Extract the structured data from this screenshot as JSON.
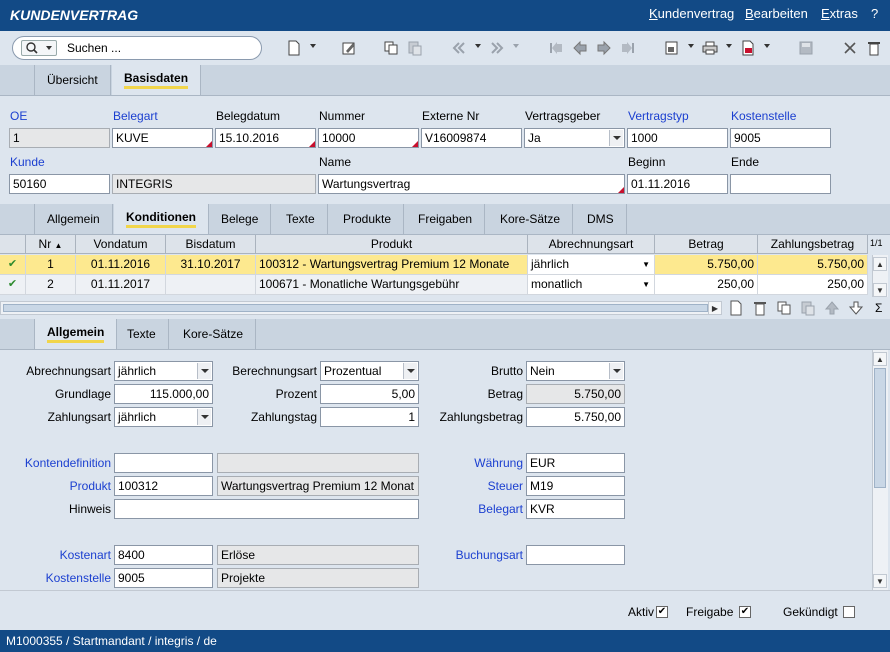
{
  "app": {
    "title": "KUNDENVERTRAG",
    "menu": [
      {
        "label": "Kundenvertrag",
        "key": "K",
        "rest": "undenvertrag"
      },
      {
        "label": "Bearbeiten",
        "key": "B",
        "rest": "earbeiten"
      },
      {
        "label": "Extras",
        "key": "E",
        "rest": "xtras"
      },
      {
        "label": "?",
        "key": "",
        "rest": "?"
      }
    ]
  },
  "toolbar": {
    "search_label": "Suchen ...",
    "icons": [
      "new-document-icon",
      "edit-icon",
      "copy-icon",
      "paste-icon",
      "fast-back-icon",
      "fast-forward-icon",
      "first-record-icon",
      "previous-record-icon",
      "next-record-icon",
      "last-record-icon",
      "export-icon",
      "print-icon",
      "pdf-icon",
      "save-icon",
      "close-icon",
      "delete-icon"
    ]
  },
  "main_tabs": [
    {
      "label": "Übersicht",
      "active": false
    },
    {
      "label": "Basisdaten",
      "active": true
    }
  ],
  "header": {
    "oe": {
      "label": "OE",
      "value": "1"
    },
    "belegart": {
      "label": "Belegart",
      "value": "KUVE"
    },
    "belegdatum": {
      "label": "Belegdatum",
      "value": "15.10.2016"
    },
    "nummer": {
      "label": "Nummer",
      "value": "10000"
    },
    "externe_nr": {
      "label": "Externe Nr",
      "value": "V16009874"
    },
    "vertragsgeber": {
      "label": "Vertragsgeber",
      "value": "Ja"
    },
    "vertragstyp": {
      "label": "Vertragstyp",
      "value": "1000"
    },
    "kostenstelle": {
      "label": "Kostenstelle",
      "value": "9005"
    },
    "kunde": {
      "label": "Kunde",
      "value": "50160",
      "name_value": "INTEGRIS"
    },
    "name": {
      "label": "Name",
      "value": "Wartungsvertrag"
    },
    "beginn": {
      "label": "Beginn",
      "value": "01.11.2016"
    },
    "ende": {
      "label": "Ende",
      "value": ""
    }
  },
  "sub_tabs": [
    {
      "label": "Allgemein",
      "active": false
    },
    {
      "label": "Konditionen",
      "active": true
    },
    {
      "label": "Belege",
      "active": false
    },
    {
      "label": "Texte",
      "active": false
    },
    {
      "label": "Produkte",
      "active": false
    },
    {
      "label": "Freigaben",
      "active": false
    },
    {
      "label": "Kore-Sätze",
      "active": false
    },
    {
      "label": "DMS",
      "active": false
    }
  ],
  "grid": {
    "columns": [
      "Nr",
      "Vondatum",
      "Bisdatum",
      "Produkt",
      "Abrechnungsart",
      "Betrag",
      "Zahlungsbetrag"
    ],
    "page_indicator": "1/1",
    "sum_symbol": "Σ",
    "rows": [
      {
        "check": "✔",
        "nr": "1",
        "vondatum": "01.11.2016",
        "bisdatum": "31.10.2017",
        "produkt": "100312 - Wartungsvertrag Premium 12 Monate",
        "abrechnungsart": "jährlich",
        "betrag": "5.750,00",
        "zahlungsbetrag": "5.750,00"
      },
      {
        "check": "✔",
        "nr": "2",
        "vondatum": "01.11.2017",
        "bisdatum": "",
        "produkt": "100671 - Monatliche Wartungsgebühr",
        "abrechnungsart": "monatlich",
        "betrag": "250,00",
        "zahlungsbetrag": "250,00"
      }
    ]
  },
  "detail_tabs": [
    {
      "label": "Allgemein",
      "active": true
    },
    {
      "label": "Texte",
      "active": false
    },
    {
      "label": "Kore-Sätze",
      "active": false
    }
  ],
  "detail": {
    "abrechnungsart": {
      "label": "Abrechnungsart",
      "value": "jährlich"
    },
    "berechnungsart": {
      "label": "Berechnungsart",
      "value": "Prozentual"
    },
    "brutto": {
      "label": "Brutto",
      "value": "Nein"
    },
    "grundlage": {
      "label": "Grundlage",
      "value": "115.000,00"
    },
    "prozent": {
      "label": "Prozent",
      "value": "5,00"
    },
    "betrag": {
      "label": "Betrag",
      "value": "5.750,00"
    },
    "zahlungsart": {
      "label": "Zahlungsart",
      "value": "jährlich"
    },
    "zahlungstag": {
      "label": "Zahlungstag",
      "value": "1"
    },
    "zahlungsbetrag": {
      "label": "Zahlungsbetrag",
      "value": "5.750,00"
    },
    "kontendefinition": {
      "label": "Kontendefinition",
      "value": "",
      "desc": ""
    },
    "produkt": {
      "label": "Produkt",
      "value": "100312",
      "desc": "Wartungsvertrag Premium 12 Monat"
    },
    "hinweis": {
      "label": "Hinweis",
      "value": ""
    },
    "waehrung": {
      "label": "Währung",
      "value": "EUR"
    },
    "steuer": {
      "label": "Steuer",
      "value": "M19"
    },
    "belegart": {
      "label": "Belegart",
      "value": "KVR"
    },
    "kostenart": {
      "label": "Kostenart",
      "value": "8400",
      "desc": "Erlöse"
    },
    "kostenstelle": {
      "label": "Kostenstelle",
      "value": "9005",
      "desc": "Projekte"
    },
    "buchungsart": {
      "label": "Buchungsart",
      "value": ""
    }
  },
  "footer": {
    "aktiv": {
      "label": "Aktiv",
      "checked": true
    },
    "freigabe": {
      "label": "Freigabe",
      "checked": true
    },
    "gekuendigt": {
      "label": "Gekündigt",
      "checked": false
    }
  },
  "status": {
    "text": "M1000355 / Startmandant / integris / de"
  },
  "colors": {
    "title_bg": "#124a86",
    "link": "#1b3fd0",
    "selected_row": "#fde98f",
    "tab_underline": "#f1d54a"
  }
}
